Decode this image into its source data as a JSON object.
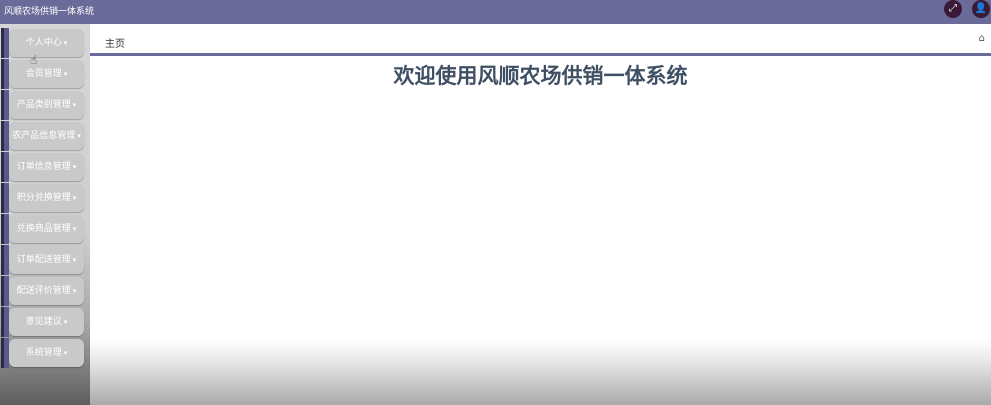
{
  "app": {
    "title": "风顺农场供销一体系统"
  },
  "topbar": {
    "fullscreen_icon": "expand-arrows-icon",
    "user_icon": "user-icon"
  },
  "sidebar": {
    "caret_glyph": "▾",
    "items": [
      {
        "label": "个人中心"
      },
      {
        "label": "会员管理"
      },
      {
        "label": "产品类别管理"
      },
      {
        "label": "农产品信息管理"
      },
      {
        "label": "订单信息管理"
      },
      {
        "label": "积分兑换管理"
      },
      {
        "label": "兑换商品管理"
      },
      {
        "label": "订单配送管理"
      },
      {
        "label": "配送评价管理"
      },
      {
        "label": "意见建议"
      },
      {
        "label": "系统管理"
      }
    ]
  },
  "breadcrumb": {
    "current": "主页"
  },
  "main": {
    "welcome_text": "欢迎使用风顺农场供销一体系统"
  },
  "colors": {
    "accent": "#6b6b9a",
    "welcome_text": "#3f4f64"
  }
}
